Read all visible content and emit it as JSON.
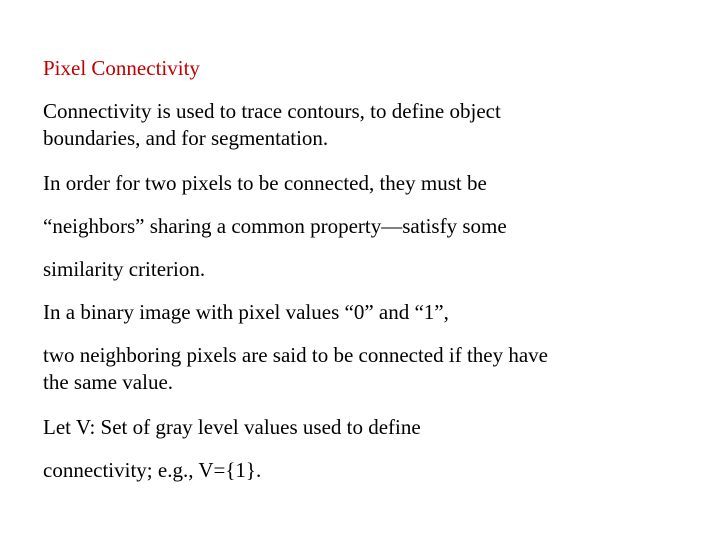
{
  "slide": {
    "title": "Pixel Connectivity",
    "title_color": "#c00000",
    "paragraphs": [
      [
        "Connectivity is used to trace contours, to define object",
        "boundaries, and for segmentation."
      ],
      [
        "In order for two pixels to be connected, they must be"
      ],
      [
        "“neighbors” sharing a common property—satisfy some"
      ],
      [
        "similarity criterion."
      ],
      [
        "In a binary image with pixel values “0” and “1”,"
      ],
      [
        "two neighboring pixels are said to be connected if they have",
        "the same value."
      ],
      [
        "Let V: Set of gray level values used to define"
      ],
      [
        "connectivity; e.g., V={1}."
      ]
    ]
  }
}
